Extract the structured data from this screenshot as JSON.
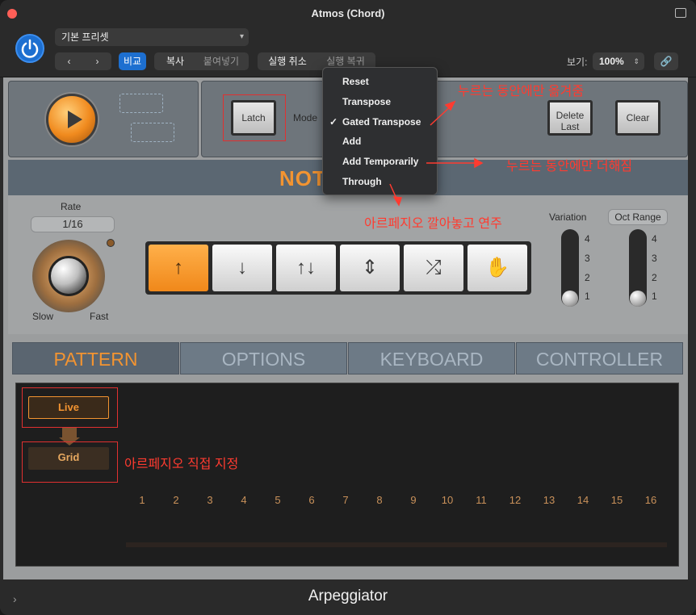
{
  "window": {
    "title": "Atmos (Chord)",
    "footer_title": "Arpeggiator"
  },
  "toolbar": {
    "preset": "기본 프리셋",
    "compare": "비교",
    "copy": "복사",
    "paste": "붙여넣기",
    "undo": "실행 취소",
    "redo": "실행 복귀",
    "view_label": "보기:",
    "zoom": "100%"
  },
  "controls": {
    "latch": "Latch",
    "mode_label": "Mode",
    "delete_last_line1": "Delete",
    "delete_last_line2": "Last",
    "clear": "Clear",
    "notes_title": "NOT"
  },
  "mode_menu": {
    "items": [
      "Reset",
      "Transpose",
      "Gated Transpose",
      "Add",
      "Add Temporarily",
      "Through"
    ],
    "checked_index": 2
  },
  "rate": {
    "label": "Rate",
    "value": "1/16",
    "slow": "Slow",
    "fast": "Fast"
  },
  "variation": {
    "label": "Variation",
    "ticks": [
      "4",
      "3",
      "2",
      "1"
    ],
    "value": 1
  },
  "oct_range": {
    "label": "Oct Range",
    "ticks": [
      "4",
      "3",
      "2",
      "1"
    ],
    "value": 1
  },
  "arp_directions": [
    "↑",
    "↓",
    "↑↓",
    "⇕",
    "⤮",
    "✋"
  ],
  "tabs": [
    "PATTERN",
    "OPTIONS",
    "KEYBOARD",
    "CONTROLLER"
  ],
  "pattern": {
    "live": "Live",
    "grid": "Grid",
    "steps": [
      "1",
      "2",
      "3",
      "4",
      "5",
      "6",
      "7",
      "8",
      "9",
      "10",
      "11",
      "12",
      "13",
      "14",
      "15",
      "16"
    ]
  },
  "annotations": {
    "gated": "누르는 동안에만 옮겨줌",
    "add_temp": "누르는 동안에만 더해짐",
    "through": "아르페지오 깔아놓고 연주",
    "grid": "아르페지오 직접 지정"
  },
  "colors": {
    "accent_orange": "#f39431",
    "annotation_red": "#ff3b30",
    "power_blue": "#1d6fd0"
  }
}
